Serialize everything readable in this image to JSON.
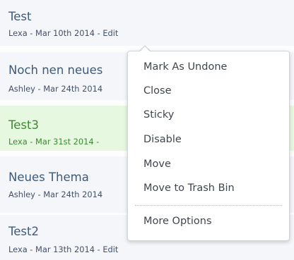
{
  "threads": [
    {
      "title": "Test",
      "author": "Lexa",
      "date": "Mar 10th 2014",
      "edit": "Edit"
    },
    {
      "title": "Noch nen neues",
      "author": "Ashley",
      "date": "Mar 24th 2014"
    },
    {
      "title": "Test3",
      "author": "Lexa",
      "date": "Mar 31st 2014"
    },
    {
      "title": "Neues Thema",
      "author": "Ashley",
      "date": "Mar 24th 2014"
    },
    {
      "title": "Test2",
      "author": "Lexa",
      "date": "Mar 13th 2014",
      "edit": "Edit"
    }
  ],
  "separator": " - ",
  "menu": {
    "items": [
      "Mark As Undone",
      "Close",
      "Sticky",
      "Disable",
      "Move",
      "Move to Trash Bin"
    ],
    "more_options": "More Options"
  },
  "colors": {
    "title_link": "#3e5a7a",
    "highlight_bg": "#e6f8df",
    "highlight_text": "#3c8a33"
  }
}
